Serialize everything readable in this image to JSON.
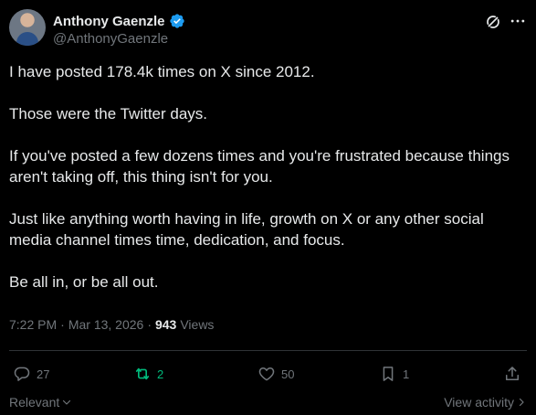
{
  "author": {
    "display_name": "Anthony Gaenzle",
    "handle": "@AnthonyGaenzle",
    "verified": true
  },
  "post": {
    "paragraphs": [
      "I have posted 178.4k times on X since 2012.",
      "Those were the Twitter days.",
      "If you've posted a few dozens times and you're frustrated because things aren't taking off, this thing isn't for you.",
      "Just like anything worth having in life, growth on X or any other social media channel times time, dedication, and focus.",
      "Be all in, or be all out."
    ],
    "time": "7:22 PM",
    "separator": "·",
    "date": "Mar 13, 2026",
    "views_count": "943",
    "views_label": "Views"
  },
  "actions": {
    "replies": "27",
    "reposts": "2",
    "likes": "50",
    "bookmarks": "1"
  },
  "footer": {
    "sort_label": "Relevant",
    "activity_label": "View activity"
  },
  "colors": {
    "background": "#000000",
    "text": "#e7e9ea",
    "muted": "#71767b",
    "verified": "#1d9bf0",
    "repost_active": "#00ba7c",
    "divider": "#2f3336"
  },
  "icons": [
    "verified-badge-icon",
    "grok-icon",
    "more-icon",
    "reply-icon",
    "repost-icon",
    "like-icon",
    "bookmark-icon",
    "share-icon",
    "chevron-down-icon",
    "chevron-right-icon"
  ]
}
